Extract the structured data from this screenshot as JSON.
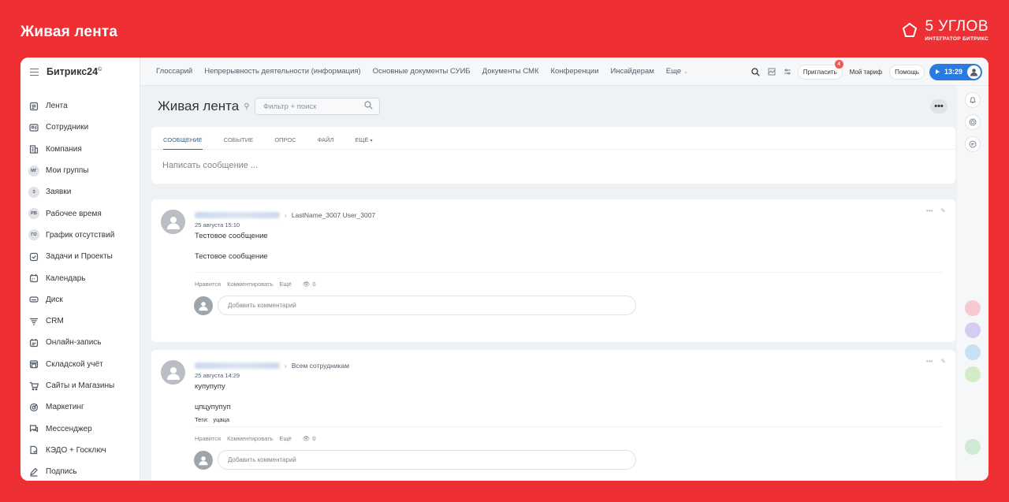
{
  "frame": {
    "title": "Живая лента",
    "brand_name": "5 УГЛОВ",
    "brand_sub": "ИНТЕГРАТОР БИТРИКС"
  },
  "sidebar": {
    "logo": "Битрикс24",
    "logo_mark": "©",
    "items": [
      {
        "label": "Лента",
        "icon": "feed-icon"
      },
      {
        "label": "Сотрудники",
        "icon": "employees-icon"
      },
      {
        "label": "Компания",
        "icon": "company-icon"
      },
      {
        "label": "Мои группы",
        "icon": "groups-badge",
        "badge": "МГ"
      },
      {
        "label": "Заявки",
        "icon": "requests-badge",
        "badge": "З"
      },
      {
        "label": "Рабочее время",
        "icon": "worktime-badge",
        "badge": "РВ"
      },
      {
        "label": "График отсутствий",
        "icon": "absence-badge",
        "badge": "ГО"
      },
      {
        "label": "Задачи и Проекты",
        "icon": "tasks-icon"
      },
      {
        "label": "Календарь",
        "icon": "calendar-icon"
      },
      {
        "label": "Диск",
        "icon": "disk-icon"
      },
      {
        "label": "CRM",
        "icon": "crm-icon"
      },
      {
        "label": "Онлайн-запись",
        "icon": "booking-icon"
      },
      {
        "label": "Складской учёт",
        "icon": "warehouse-icon"
      },
      {
        "label": "Сайты и Магазины",
        "icon": "cart-icon"
      },
      {
        "label": "Маркетинг",
        "icon": "marketing-icon"
      },
      {
        "label": "Мессенджер",
        "icon": "messenger-icon"
      },
      {
        "label": "КЭДО + Госключ",
        "icon": "kedo-icon"
      },
      {
        "label": "Подпись",
        "icon": "signature-icon"
      }
    ]
  },
  "topbar": {
    "nav": [
      "Глоссарий",
      "Непрерывность деятельности (информация)",
      "Основные документы СУИБ",
      "Документы СМК",
      "Конференции",
      "Инсайдерам",
      "Еще"
    ],
    "invite": "Пригласить",
    "invite_count": "4",
    "tariff": "Мой тариф",
    "help": "Помощь",
    "time": "13:29"
  },
  "main": {
    "title": "Живая лента",
    "search_placeholder": "Фильтр + поиск",
    "more": "•••"
  },
  "composer": {
    "tabs": [
      "СООБЩЕНИЕ",
      "СОБЫТИЕ",
      "ОПРОС",
      "ФАЙЛ",
      "ЕЩЁ"
    ],
    "placeholder": "Написать сообщение ..."
  },
  "posts": [
    {
      "recipient": "LastName_3007 User_3007",
      "date": "25 августа 15:10",
      "title": "Тестовое сообщение",
      "text": "Тестовое сообщение",
      "like": "Нравится",
      "comment": "Комментировать",
      "more": "Ещё",
      "views": "0",
      "comment_placeholder": "Добавить комментарий"
    },
    {
      "recipient": "Всем сотрудникам",
      "date": "25 августа 14:29",
      "title": "купупупу",
      "text": "цпцупупуп",
      "tags_label": "Теги:",
      "tags_value": "уцаца",
      "like": "Нравится",
      "comment": "Комментировать",
      "more": "Ещё",
      "views": "0",
      "comment_placeholder": "Добавить комментарий"
    }
  ],
  "colors": {
    "frame_bg": "#ee3035",
    "accent": "#2067b0",
    "clock_bg": "#2a7ae2"
  }
}
